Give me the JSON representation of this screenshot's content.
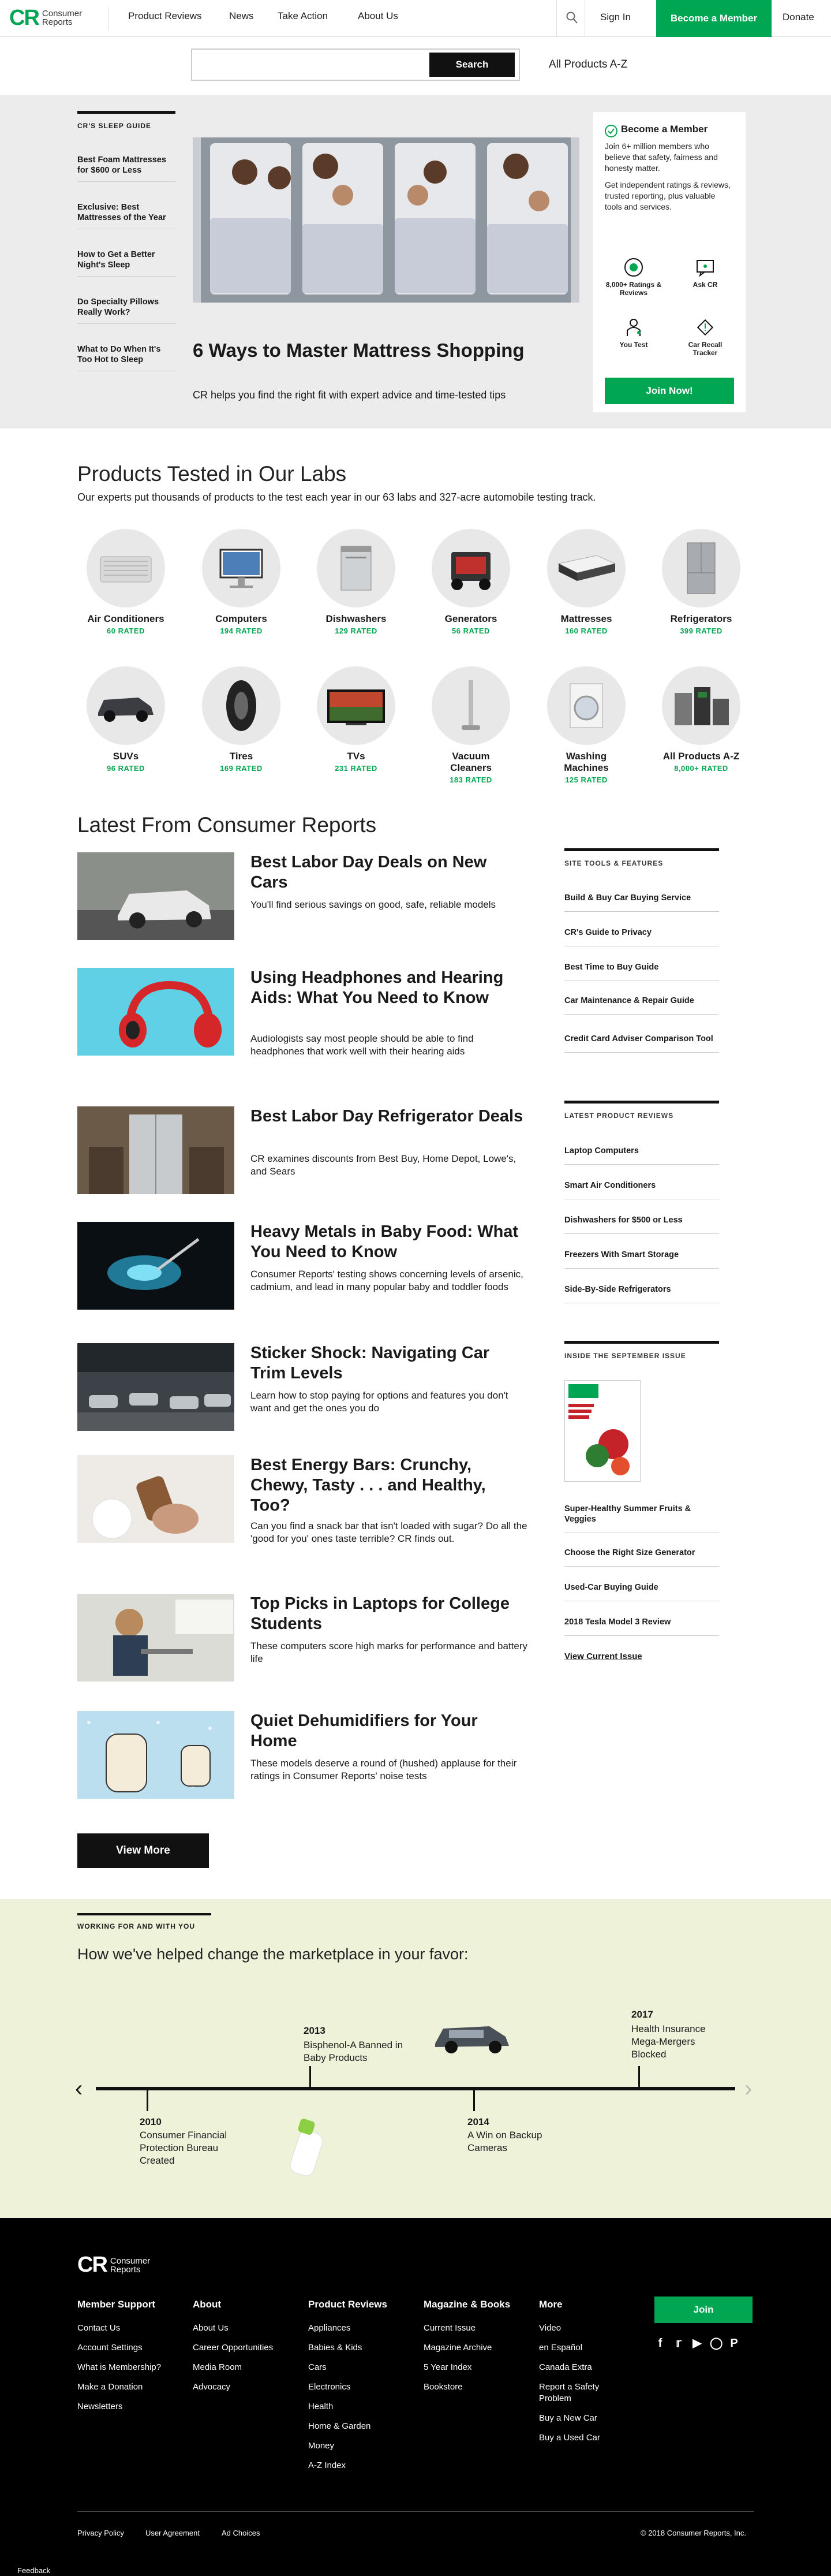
{
  "header": {
    "logo_mark": "CR",
    "logo_name_line1": "Consumer",
    "logo_name_line2": "Reports",
    "nav": [
      "Product Reviews",
      "News",
      "Take Action",
      "About Us"
    ],
    "sign_in": "Sign In",
    "become_member": "Become a Member",
    "donate": "Donate"
  },
  "search": {
    "placeholder": "",
    "button": "Search",
    "all_products": "All Products A-Z"
  },
  "hero": {
    "sidebar_title": "CR'S SLEEP GUIDE",
    "sidebar_items": [
      "Best Foam Mattresses for $600 or Less",
      "Exclusive: Best Mattresses of the Year",
      "How to Get a Better Night's Sleep",
      "Do Specialty Pillows Really Work?",
      "What to Do When It's Too Hot to Sleep"
    ],
    "title": "6 Ways to Master Mattress Shopping",
    "subtitle": "CR helps you find the right fit with expert advice and time-tested tips",
    "member_box": {
      "title": "Become a Member",
      "text1": "Join 6+ million members who believe that safety, fairness and honesty matter.",
      "text2": "Get independent ratings & reviews, trusted reporting, plus valuable tools and services.",
      "features": [
        "8,000+ Ratings & Reviews",
        "Ask CR",
        "You Test",
        "Car Recall Tracker"
      ],
      "button": "Join Now!"
    }
  },
  "products": {
    "title": "Products Tested in Our Labs",
    "subtitle": "Our experts put thousands of products to the test each year in our 63 labs and 327-acre automobile testing track.",
    "items": [
      {
        "name": "Air Conditioners",
        "rated": "60 RATED"
      },
      {
        "name": "Computers",
        "rated": "194 RATED"
      },
      {
        "name": "Dishwashers",
        "rated": "129 RATED"
      },
      {
        "name": "Generators",
        "rated": "56 RATED"
      },
      {
        "name": "Mattresses",
        "rated": "160 RATED"
      },
      {
        "name": "Refrigerators",
        "rated": "399 RATED"
      },
      {
        "name": "SUVs",
        "rated": "96 RATED"
      },
      {
        "name": "Tires",
        "rated": "169 RATED"
      },
      {
        "name": "TVs",
        "rated": "231 RATED"
      },
      {
        "name": "Vacuum Cleaners",
        "rated": "183 RATED"
      },
      {
        "name": "Washing Machines",
        "rated": "125 RATED"
      },
      {
        "name": "All Products A-Z",
        "rated": "8,000+ RATED"
      }
    ]
  },
  "latest": {
    "title": "Latest From Consumer Reports",
    "articles": [
      {
        "title": "Best Labor Day Deals on New Cars",
        "desc": "You'll find serious savings on good, safe, reliable models"
      },
      {
        "title": "Using Headphones and Hearing Aids: What You Need to Know",
        "desc": "Audiologists say most people should be able to find headphones that work well with their hearing aids"
      },
      {
        "title": "Best Labor Day Refrigerator Deals",
        "desc": "CR examines discounts from Best Buy, Home Depot, Lowe's, and Sears"
      },
      {
        "title": "Heavy Metals in Baby Food: What You Need to Know",
        "desc": "Consumer Reports' testing shows concerning levels of arsenic, cadmium, and lead in many popular baby and toddler foods"
      },
      {
        "title": "Sticker Shock: Navigating Car Trim Levels",
        "desc": "Learn how to stop paying for options and features you don't want and get the ones you do"
      },
      {
        "title": "Best Energy Bars: Crunchy, Chewy, Tasty . . . and Healthy, Too?",
        "desc": "Can you find a snack bar that isn't loaded with sugar? Do all the 'good for you' ones taste terrible? CR finds out."
      },
      {
        "title": "Top Picks in Laptops for College Students",
        "desc": "These computers score high marks for performance and battery life"
      },
      {
        "title": "Quiet Dehumidifiers for Your Home",
        "desc": "These models deserve a round of (hushed) applause for their ratings in Consumer Reports' noise tests"
      }
    ],
    "view_more": "View More"
  },
  "side": {
    "tools_title": "SITE TOOLS & FEATURES",
    "tools": [
      "Build & Buy Car Buying Service",
      "CR's Guide to Privacy",
      "Best Time to Buy Guide",
      "Car Maintenance & Repair Guide",
      "Credit Card Adviser Comparison Tool"
    ],
    "reviews_title": "LATEST PRODUCT REVIEWS",
    "reviews": [
      "Laptop Computers",
      "Smart Air Conditioners",
      "Dishwashers for $500 or Less",
      "Freezers With Smart Storage",
      "Side-By-Side Refrigerators"
    ],
    "issue_title": "INSIDE THE SEPTEMBER ISSUE",
    "issue": [
      "Super-Healthy Summer Fruits & Veggies",
      "Choose the Right Size Generator",
      "Used-Car Buying Guide",
      "2018 Tesla Model 3 Review"
    ],
    "view_issue": "View Current Issue"
  },
  "marketplace": {
    "kicker": "WORKING FOR AND WITH YOU",
    "title": "How we've helped change the marketplace in your favor:",
    "events": [
      {
        "year": "2010",
        "text": "Consumer Financial Protection Bureau Created"
      },
      {
        "year": "2013",
        "text": "Bisphenol-A Banned in Baby Products"
      },
      {
        "year": "2014",
        "text": "A Win on Backup Cameras"
      },
      {
        "year": "2017",
        "text": "Health Insurance Mega-Mergers Blocked"
      }
    ]
  },
  "footer": {
    "columns": [
      {
        "title": "Member Support",
        "items": [
          "Contact Us",
          "Account Settings",
          "What is Membership?",
          "Make a Donation",
          "Newsletters"
        ]
      },
      {
        "title": "About",
        "items": [
          "About Us",
          "Career Opportunities",
          "Media Room",
          "Advocacy"
        ]
      },
      {
        "title": "Product Reviews",
        "items": [
          "Appliances",
          "Babies & Kids",
          "Cars",
          "Electronics",
          "Health",
          "Home & Garden",
          "Money",
          "A-Z Index"
        ]
      },
      {
        "title": "Magazine & Books",
        "items": [
          "Current Issue",
          "Magazine Archive",
          "5 Year Index",
          "Bookstore"
        ]
      },
      {
        "title": "More",
        "items": [
          "Video",
          "en Español",
          "Canada Extra",
          "Report a Safety Problem",
          "Buy a New Car",
          "Buy a Used Car"
        ]
      }
    ],
    "join": "Join",
    "legal": [
      "Privacy Policy",
      "User Agreement",
      "Ad Choices"
    ],
    "copyright": "© 2018 Consumer Reports, Inc.",
    "feedback": "Feedback"
  },
  "colors": {
    "brand_green": "#00a651",
    "dark": "#111111",
    "hero_bg": "#ececec",
    "market_bg": "#eef2d9"
  }
}
